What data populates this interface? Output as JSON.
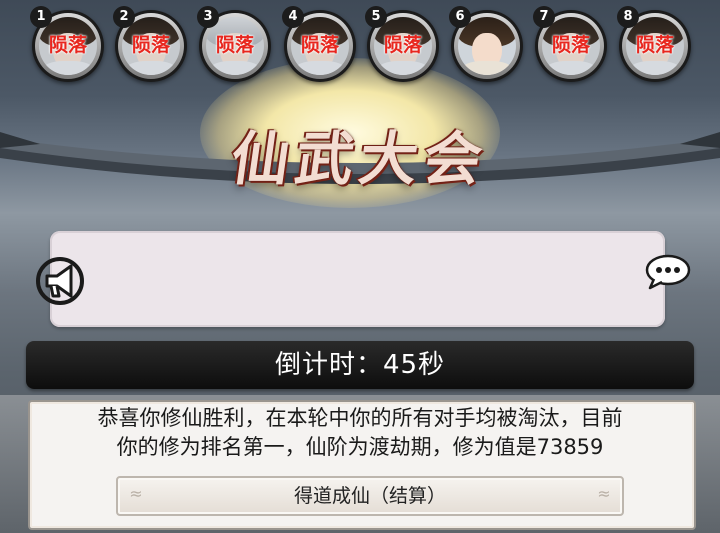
{
  "players": [
    {
      "number": "1",
      "status": "陨落"
    },
    {
      "number": "2",
      "status": "陨落"
    },
    {
      "number": "3",
      "status": "陨落"
    },
    {
      "number": "4",
      "status": "陨落"
    },
    {
      "number": "5",
      "status": "陨落"
    },
    {
      "number": "6",
      "status": ""
    },
    {
      "number": "7",
      "status": "陨落"
    },
    {
      "number": "8",
      "status": "陨落"
    }
  ],
  "banner": {
    "title": "仙武大会"
  },
  "broadcast": {
    "horn_icon": "horn-icon",
    "chat_icon": "chat-bubble-icon",
    "message": ""
  },
  "countdown": {
    "text": "倒计时：45秒"
  },
  "result": {
    "line1": "恭喜你修仙胜利，在本轮中你的所有对手均被淘汰，目前",
    "line2": "你的修为排名第一，仙阶为渡劫期，修为值是73859",
    "button_label": "得道成仙（结算）"
  },
  "colors": {
    "status_red": "#e8261e",
    "countdown_bg": "#111111",
    "panel_bg": "#ece5ea"
  }
}
